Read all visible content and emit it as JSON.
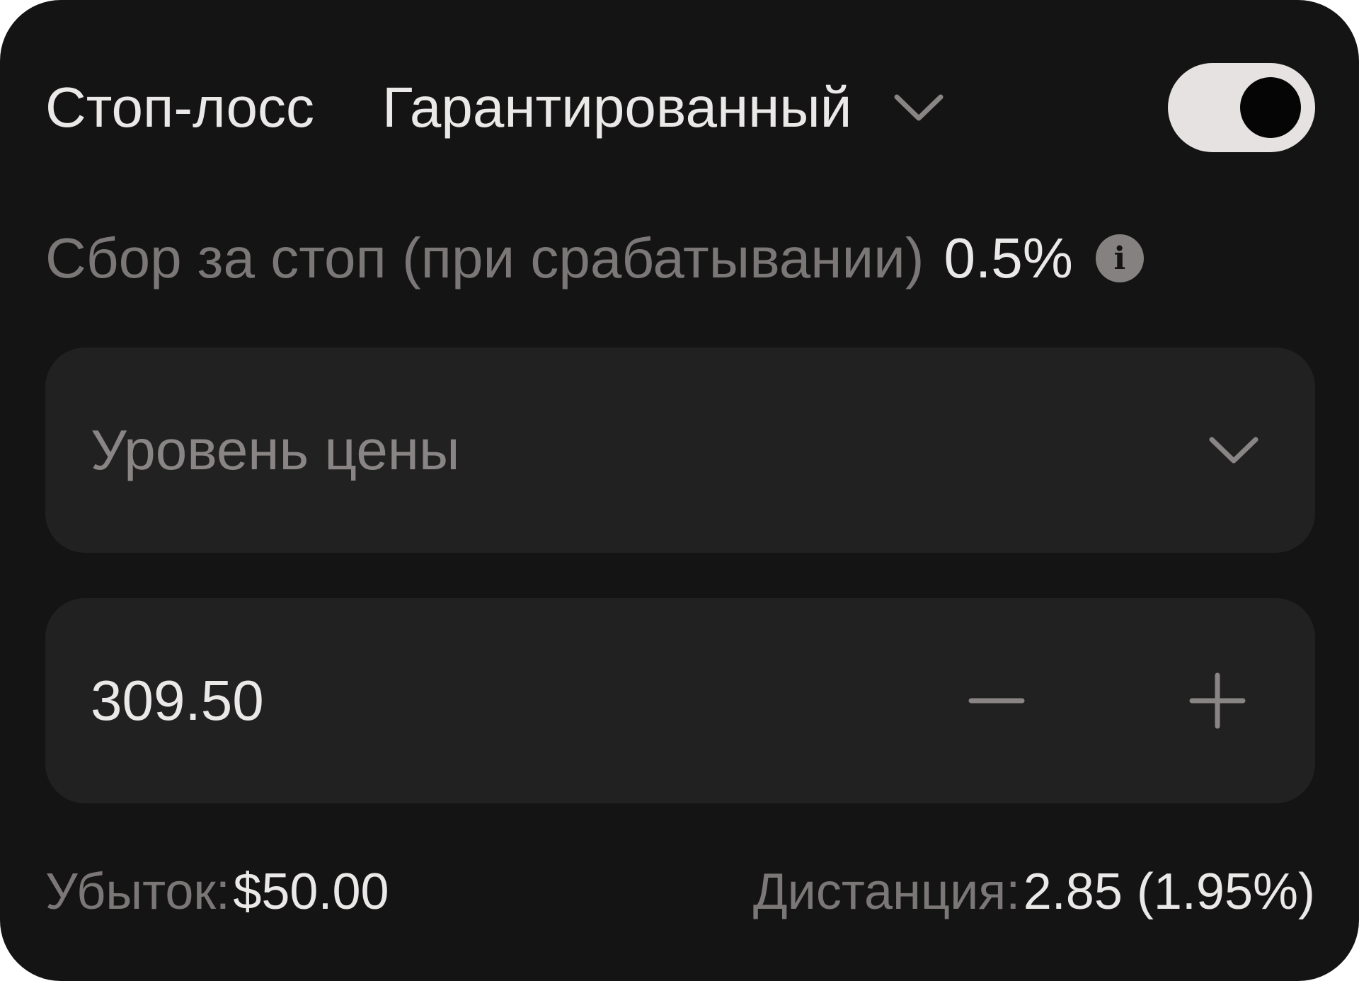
{
  "header": {
    "title": "Стоп-лосс",
    "type_selected": "Гарантированный",
    "toggle_on": true
  },
  "fee": {
    "label": "Сбор за стоп (при срабатывании)",
    "value": "0.5%",
    "info_icon": "info-icon"
  },
  "level_select": {
    "label": "Уровень цены"
  },
  "price_input": {
    "value": "309.50"
  },
  "footer": {
    "loss_label": "Убыток:",
    "loss_value": "$50.00",
    "distance_label": "Дистанция:",
    "distance_value": "2.85 (1.95%)"
  },
  "colors": {
    "panel_bg": "#151415",
    "field_bg": "#222122",
    "text_primary": "#ebe8e8",
    "text_muted": "#7b7777",
    "toggle_track": "#e6e2e2",
    "toggle_knob": "#050505"
  }
}
